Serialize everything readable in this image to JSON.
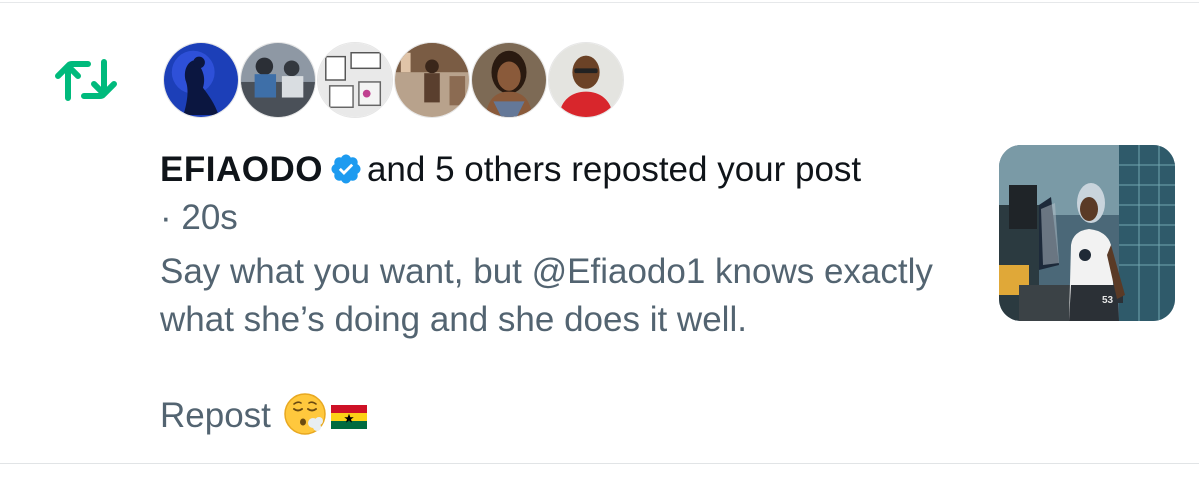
{
  "notification": {
    "username": "EFIAODO",
    "action_text": "and 5 others reposted your post",
    "timestamp": "· 20s",
    "post_text": "Say what you want, but @Efiaodo1 knows exactly what she’s doing and she does it well.",
    "repost_label": "Repost",
    "repost_emoji": "face-exhaling-emoji",
    "flag_emoji": "ghana-flag",
    "thumbnail_jersey_number": "53"
  },
  "colors": {
    "repost_green": "#00ba7c",
    "verified_blue": "#1d9bf0",
    "primary_text": "#0f1419",
    "secondary_text": "#536471"
  },
  "icons": {
    "repost": "repost-icon",
    "verified": "verified-badge-icon"
  }
}
